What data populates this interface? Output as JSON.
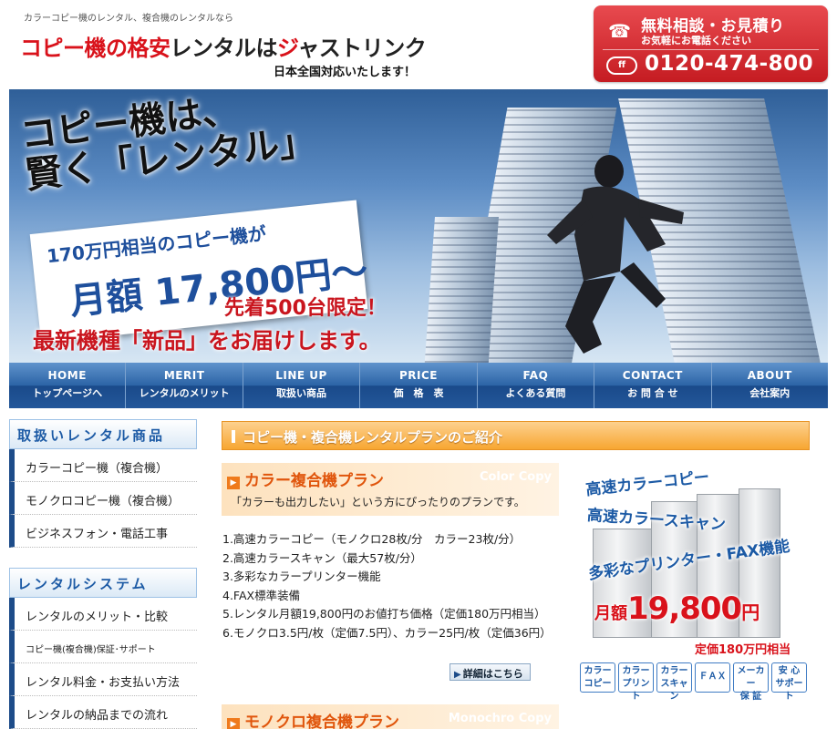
{
  "header": {
    "tagline": "カラーコピー機のレンタル、複合機のレンタルなら",
    "title_part1": "コピー機の格安",
    "title_part2": "レンタルは",
    "title_part3": "ジ",
    "title_part4": "ャストリンク",
    "subtitle": "日本全国対応いたします！"
  },
  "contact": {
    "line1": "無料相談・お見積り",
    "line2": "お気軽にお電話ください",
    "freedial": "ff",
    "phone": "0120-474-800"
  },
  "hero": {
    "headline1": "コピー機は、",
    "headline2": "賢く「レンタル」",
    "card_line1": "170万円相当のコピー機が",
    "card_line2": "月額 17,800円〜",
    "limited": "先着500台限定！",
    "newest": "最新機種「新品」をお届けします。"
  },
  "nav": [
    {
      "en": "HOME",
      "jp": "トップページへ"
    },
    {
      "en": "MERIT",
      "jp": "レンタルのメリット"
    },
    {
      "en": "LINE UP",
      "jp": "取扱い商品"
    },
    {
      "en": "PRICE",
      "jp": "価　格　表"
    },
    {
      "en": "FAQ",
      "jp": "よくある質問"
    },
    {
      "en": "CONTACT",
      "jp": "お 問 合 せ"
    },
    {
      "en": "ABOUT",
      "jp": "会社案内"
    }
  ],
  "sidebar": {
    "products_heading": "取扱いレンタル商品",
    "products": [
      "カラーコピー機（複合機）",
      "モノクロコピー機（複合機）",
      "ビジネスフォン・電話工事"
    ],
    "system_heading": "レンタルシステム",
    "system": [
      "レンタルのメリット・比較",
      "コピー機(複合機)保証･サポート",
      "レンタル料金・お支払い方法",
      "レンタルの納品までの流れ"
    ]
  },
  "main": {
    "heading": "コピー機・複合機レンタルプランのご紹介",
    "color_plan": {
      "title": "カラー複合機プラン",
      "watermark": "Color Copy",
      "desc": "「カラーも出力したい」という方にぴったりのプランです。",
      "features": [
        "1.高速カラーコピー（モノクロ28枚/分　カラー23枚/分）",
        "2.高速カラースキャン（最大57枚/分）",
        "3.多彩なカラープリンター機能",
        "4.FAX標準装備",
        "5.レンタル月額19,800円のお値打ち価格（定価180万円相当）",
        "6.モノクロ3.5円/枚（定価7.5円）、カラー25円/枚（定価36円）"
      ],
      "detail_button": "詳細はこちら"
    },
    "mono_plan": {
      "title": "モノクロ複合機プラン",
      "watermark": "Monochro Copy"
    }
  },
  "promo": {
    "line1": "高速カラーコピー",
    "line2": "高速カラースキャン",
    "line3": "多彩なプリンター・FAX機能",
    "price_prefix": "月額",
    "price": "19,800",
    "price_unit": "円",
    "original": "定価180万円相当",
    "badges": [
      {
        "l1": "カラー",
        "l2": "コピー"
      },
      {
        "l1": "カラー",
        "l2": "プリント"
      },
      {
        "l1": "カラー",
        "l2": "スキャン"
      },
      {
        "l1": "ＦＡＸ",
        "l2": ""
      },
      {
        "l1": "メーカー",
        "l2": "保 証"
      },
      {
        "l1": "安 心",
        "l2": "サポート"
      }
    ]
  },
  "colors": {
    "brand_red": "#d9121b",
    "nav_blue": "#1d4c89",
    "accent_orange": "#f7a631"
  }
}
